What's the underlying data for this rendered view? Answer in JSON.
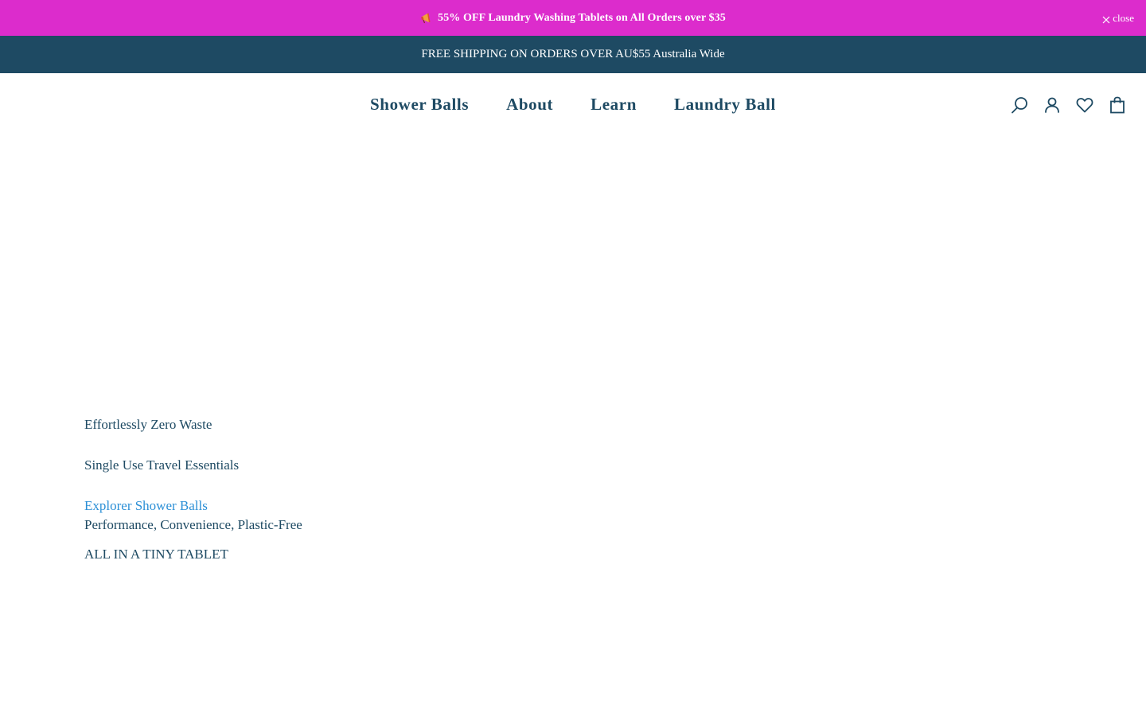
{
  "promo": {
    "icon": "megaphone-icon",
    "text": "55% OFF Laundry Washing Tablets on All Orders over $35",
    "close_label": "close",
    "background": "#dc2ccc"
  },
  "shipping": {
    "text": "FREE SHIPPING ON ORDERS OVER AU$55 Australia Wide",
    "background": "#1e4a63"
  },
  "nav": {
    "items": [
      {
        "label": "Shower Balls"
      },
      {
        "label": "About"
      },
      {
        "label": "Learn"
      },
      {
        "label": "Laundry Ball"
      }
    ],
    "icons": [
      "search-icon",
      "account-icon",
      "wishlist-icon",
      "cart-icon"
    ],
    "color": "#1e4a63"
  },
  "hero": {
    "line1": "Effortlessly Zero Waste",
    "line2": "Single Use Travel Essentials",
    "link": "Explorer Shower Balls",
    "line4": "Performance, Convenience, Plastic-Free",
    "line5": "ALL IN A TINY TABLET",
    "link_color": "#2b8fd6"
  }
}
